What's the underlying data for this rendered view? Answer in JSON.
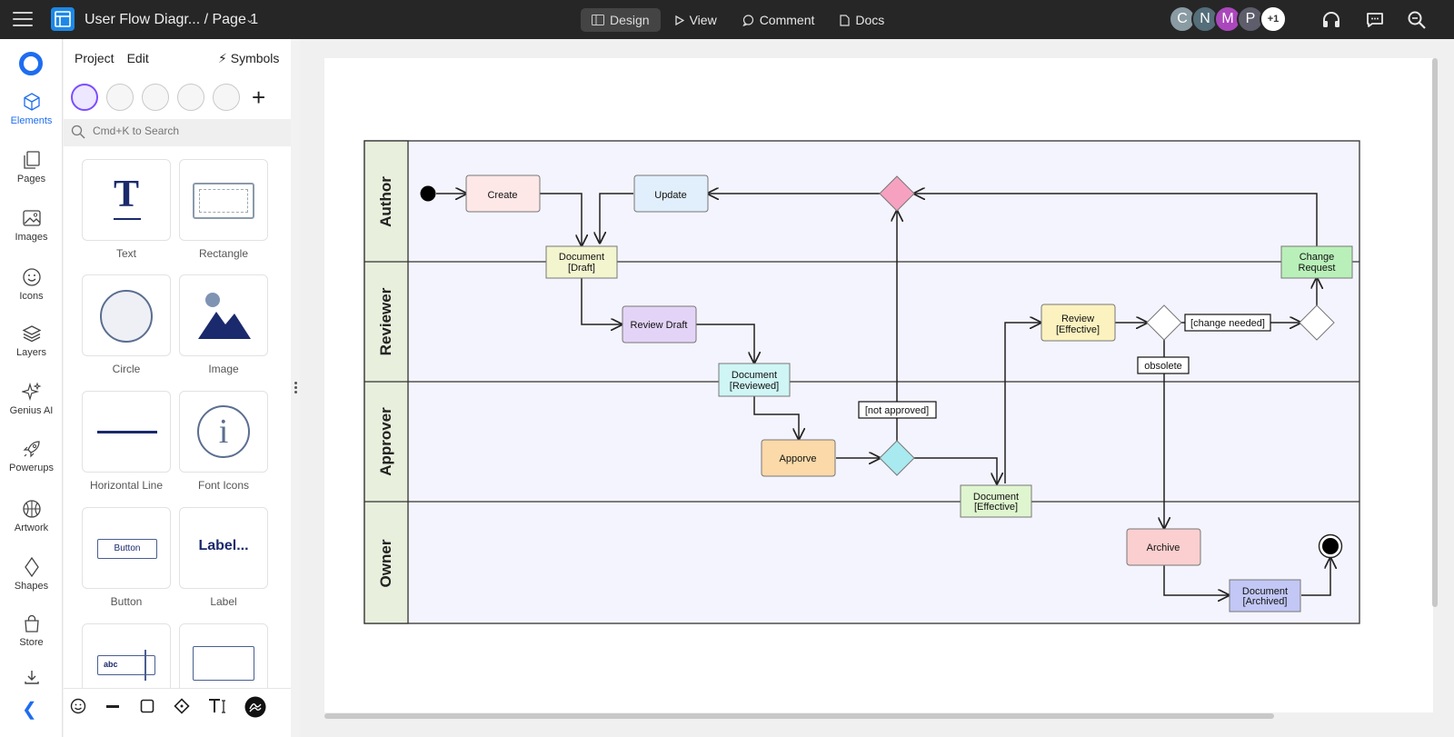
{
  "topbar": {
    "title": "User Flow Diagr... / Page 1",
    "modes": [
      {
        "label": "Design",
        "icon": "design-icon",
        "active": true
      },
      {
        "label": "View",
        "icon": "play-icon",
        "active": false
      },
      {
        "label": "Comment",
        "icon": "comment-icon",
        "active": false
      },
      {
        "label": "Docs",
        "icon": "docs-icon",
        "active": false
      }
    ],
    "avatars": [
      {
        "letter": "C",
        "color": "#8a9ba3"
      },
      {
        "letter": "N",
        "color": "#546e7a"
      },
      {
        "letter": "M",
        "color": "#ab47bc"
      },
      {
        "letter": "P",
        "color": "#5d5d6b"
      }
    ],
    "avatar_more": "+1"
  },
  "rail": {
    "items": [
      {
        "label": "Elements",
        "icon": "cube-icon"
      },
      {
        "label": "Pages",
        "icon": "pages-icon"
      },
      {
        "label": "Images",
        "icon": "image-icon"
      },
      {
        "label": "Icons",
        "icon": "smiley-icon"
      },
      {
        "label": "Layers",
        "icon": "layers-icon"
      },
      {
        "label": "Genius AI",
        "icon": "sparkle-icon"
      },
      {
        "label": "Powerups",
        "icon": "rocket-icon"
      },
      {
        "label": "Artwork",
        "icon": "basketball-icon"
      },
      {
        "label": "Shapes",
        "icon": "diamond-icon"
      },
      {
        "label": "Store",
        "icon": "bag-icon"
      }
    ]
  },
  "panel": {
    "tab_project": "Project",
    "tab_edit": "Edit",
    "symbols": "Symbols",
    "search_placeholder": "Cmd+K to Search",
    "tiles": [
      "Text",
      "Rectangle",
      "Circle",
      "Image",
      "Horizontal Line",
      "Font Icons",
      "Button",
      "Label",
      "",
      ""
    ],
    "button_preview": "Button",
    "label_preview": "Label...",
    "input_preview": "abc",
    "text_preview": "T"
  },
  "diagram": {
    "lanes": [
      "Author",
      "Reviewer",
      "Approver",
      "Owner"
    ],
    "nodes": {
      "create": "Create",
      "update": "Update",
      "doc_draft_1": "Document",
      "doc_draft_2": "[Draft]",
      "review_draft": "Review Draft",
      "doc_reviewed_1": "Document",
      "doc_reviewed_2": "[Reviewed]",
      "approve": "Apporve",
      "doc_effective_1": "Document",
      "doc_effective_2": "[Effective]",
      "review_effective_1": "Review",
      "review_effective_2": "[Effective]",
      "change_request_1": "Change",
      "change_request_2": "Request",
      "archive": "Archive",
      "doc_archived_1": "Document",
      "doc_archived_2": "[Archived]"
    },
    "guards": {
      "not_approved": "[not approved]",
      "change_needed": "[change needed]",
      "obsolete": "obsolete"
    },
    "colors": {
      "lane_header": "#e8efdc",
      "lane_body": "#f4f4fe",
      "create": "#fde7e7",
      "update": "#e1eefb",
      "doc_draft": "#f3f5cf",
      "review_draft": "#e3d4f7",
      "doc_reviewed": "#cff5f5",
      "approve": "#fbd9a8",
      "doc_effective": "#dff5cf",
      "review_effective": "#fbf2bf",
      "change_request": "#b9f0b9",
      "archive": "#fbcfcf",
      "doc_archived": "#c2c7f5",
      "decision_pink": "#f7a1c0",
      "decision_cyan": "#a9e9f0"
    }
  }
}
